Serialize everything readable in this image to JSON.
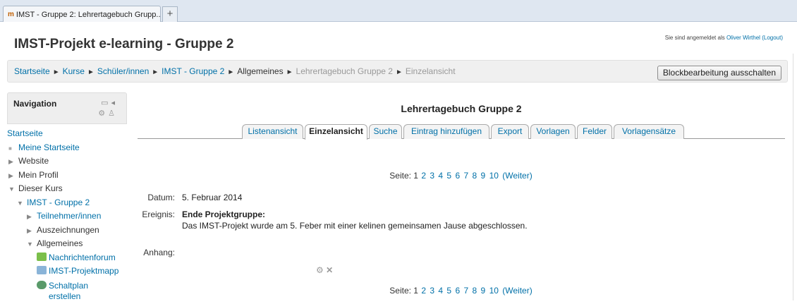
{
  "browser": {
    "tab_title": "IMST - Gruppe 2: Lehrertagebuch Grupp...",
    "new_tab": "+"
  },
  "header": {
    "title": "IMST-Projekt e-learning - Gruppe 2",
    "login_prefix": "Sie sind angemeldet als ",
    "login_user": "Oliver Wirthel",
    "logout": "(Logout)"
  },
  "breadcrumb": {
    "items": [
      "Startseite",
      "Kurse",
      "Schüler/innen",
      "IMST - Gruppe 2",
      "Allgemeines",
      "Lehrertagebuch Gruppe 2",
      "Einzelansicht"
    ],
    "separator": "►"
  },
  "edit_button": "Blockbearbeitung ausschalten",
  "navigation": {
    "title": "Navigation",
    "items": [
      {
        "label": "Startseite"
      },
      {
        "label": "Meine Startseite"
      },
      {
        "label": "Website"
      },
      {
        "label": "Mein Profil"
      },
      {
        "label": "Dieser Kurs"
      },
      {
        "label": "IMST - Gruppe 2"
      },
      {
        "label": "Teilnehmer/innen"
      },
      {
        "label": "Auszeichnungen"
      },
      {
        "label": "Allgemeines"
      },
      {
        "label": "Nachrichtenforum"
      },
      {
        "label": "IMST-Projektmapp"
      },
      {
        "label": "Schaltplan"
      },
      {
        "label": "erstellen"
      }
    ]
  },
  "main": {
    "title": "Lehrertagebuch Gruppe 2",
    "tabs": [
      "Listenansicht",
      "Einzelansicht",
      "Suche",
      "Eintrag hinzufügen",
      "Export",
      "Vorlagen",
      "Felder",
      "Vorlagensätze"
    ],
    "active_tab": "Einzelansicht",
    "pager": {
      "label": "Seite:",
      "pages": [
        "1",
        "2",
        "3",
        "4",
        "5",
        "6",
        "7",
        "8",
        "9",
        "10"
      ],
      "next": "(Weiter)"
    },
    "record": {
      "date_label": "Datum:",
      "date_value": "5. Februar 2014",
      "event_label": "Ereignis:",
      "event_title": "Ende Projektgruppe:",
      "event_text": "Das IMST-Projekt wurde am 5. Feber mit einer kelinen gemeinsamen Jause abgeschlossen.",
      "attachment_label": "Anhang:"
    }
  },
  "colors": {
    "link": "#0070a8",
    "dim": "#999999"
  },
  "icons": [
    "gear-icon",
    "delete-icon",
    "collapse-icon",
    "dock-icon",
    "assign-role-icon"
  ]
}
